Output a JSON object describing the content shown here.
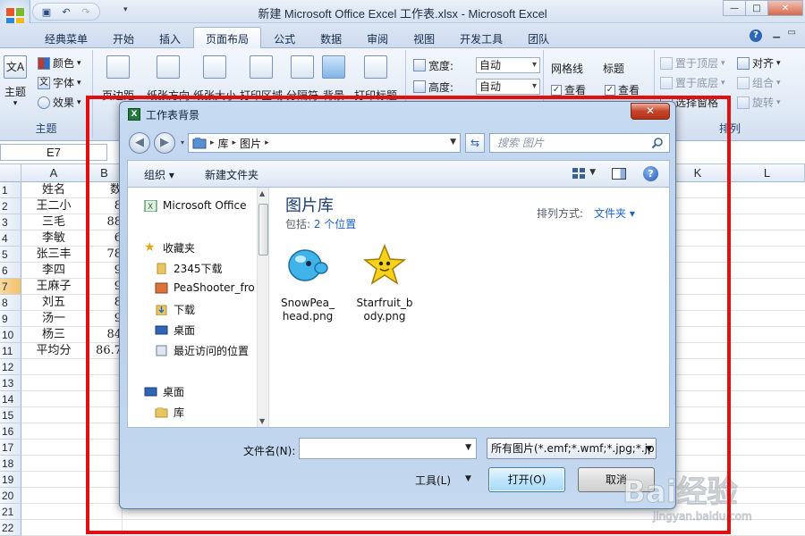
{
  "window": {
    "title": "新建 Microsoft Office Excel 工作表.xlsx - Microsoft Excel"
  },
  "ribbon": {
    "tabs": [
      {
        "label": "经典菜单"
      },
      {
        "label": "开始"
      },
      {
        "label": "插入"
      },
      {
        "label": "页面布局",
        "active": true
      },
      {
        "label": "公式"
      },
      {
        "label": "数据"
      },
      {
        "label": "审阅"
      },
      {
        "label": "视图"
      },
      {
        "label": "开发工具"
      },
      {
        "label": "团队"
      }
    ],
    "theme_group": {
      "label": "主题",
      "themes_btn": "主题",
      "colors": "颜色",
      "fonts": "字体",
      "effects": "效果"
    },
    "page_setup": {
      "margins": "页边距",
      "orientation": "纸张方向",
      "size": "纸张大小",
      "print_area": "打印区域",
      "breaks": "分隔符",
      "background": "背景",
      "print_titles": "打印标题"
    },
    "scale": {
      "width_label": "宽度:",
      "width_value": "自动",
      "height_label": "高度:",
      "height_value": "自动"
    },
    "sheet_options": {
      "gridlines": "网格线",
      "headings": "标题",
      "gridlines_view": "查看",
      "headings_view": "查看"
    },
    "arrange": {
      "label": "排列",
      "bring_forward": "置于顶层",
      "send_backward": "置于底层",
      "selection_pane": "选择窗格",
      "align": "对齐",
      "group": "组合",
      "rotate": "旋转"
    }
  },
  "sheet": {
    "name_box": "E7",
    "columns": [
      "A",
      "B",
      "K",
      "L"
    ],
    "row_numbers": [
      "1",
      "2",
      "3",
      "4",
      "5",
      "6",
      "7",
      "8",
      "9",
      "10",
      "11",
      "12",
      "13",
      "14",
      "15",
      "16",
      "17",
      "18",
      "19",
      "20",
      "21",
      "22"
    ],
    "selected_row": "7",
    "col_a": [
      "姓名",
      "王二小",
      "三毛",
      "李敏",
      "张三丰",
      "李四",
      "王麻子",
      "刘五",
      "汤一",
      "杨三",
      "平均分"
    ],
    "col_b": [
      "数",
      "8",
      "88",
      "6",
      "78",
      "9",
      "9",
      "8",
      "9",
      "84",
      "86.7"
    ]
  },
  "dialog": {
    "title": "工作表背景",
    "close": "✕",
    "address": [
      "库",
      "图片"
    ],
    "search_placeholder": "搜索 图片",
    "toolbar": {
      "organize": "组织 ▾",
      "new_folder": "新建文件夹"
    },
    "nav_items": [
      {
        "label": "Microsoft Office"
      },
      {
        "label": "收藏夹"
      },
      {
        "label": "2345下载"
      },
      {
        "label": "PeaShooter_fro"
      },
      {
        "label": "下载"
      },
      {
        "label": "桌面"
      },
      {
        "label": "最近访问的位置"
      },
      {
        "label": "桌面"
      },
      {
        "label": "库"
      }
    ],
    "library_title": "图片库",
    "library_subtitle": "包括: ",
    "library_locations": "2 个位置",
    "arrange_label": "排列方式:",
    "arrange_value": "文件夹 ▾",
    "files": [
      {
        "name": "SnowPea_head.png",
        "line1": "SnowPea_",
        "line2": "head.png",
        "icon": "snowpea-icon"
      },
      {
        "name": "Starfruit_body.png",
        "line1": "Starfruit_b",
        "line2": "ody.png",
        "icon": "starfruit-icon"
      }
    ],
    "filename_label": "文件名(N):",
    "filename_value": "",
    "filter_value": "所有图片(*.emf;*.wmf;*.jpg;*.jp",
    "tools": "工具(L)",
    "open": "打开(O)",
    "cancel": "取消"
  },
  "watermark": {
    "text": "Bai经验",
    "subtext": "jingyan.baidu.com"
  },
  "colors": {
    "highlight": "#e10f0f",
    "accent": "#1e62c8"
  }
}
